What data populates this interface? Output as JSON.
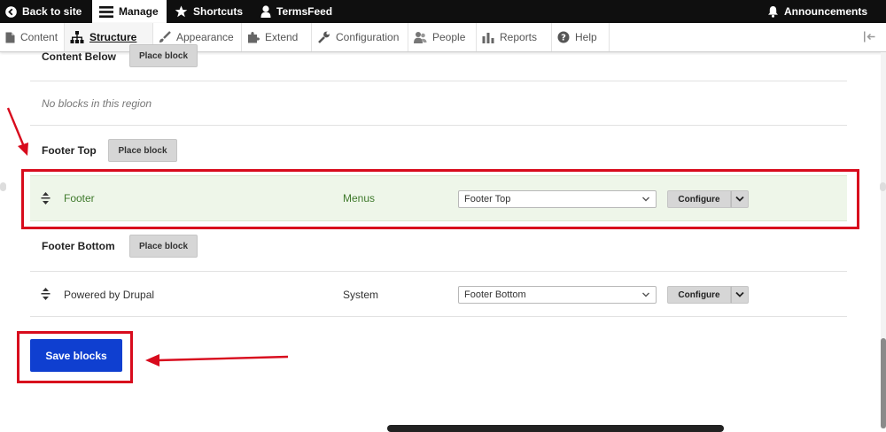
{
  "toolbar": {
    "back_to_site": "Back to site",
    "manage": "Manage",
    "shortcuts": "Shortcuts",
    "user": "TermsFeed",
    "announcements": "Announcements"
  },
  "tray": {
    "items": [
      {
        "label": "Content"
      },
      {
        "label": "Structure"
      },
      {
        "label": "Appearance"
      },
      {
        "label": "Extend"
      },
      {
        "label": "Configuration"
      },
      {
        "label": "People"
      },
      {
        "label": "Reports"
      },
      {
        "label": "Help"
      }
    ]
  },
  "regions": {
    "content_below": {
      "title": "Content Below",
      "place_block": "Place block",
      "empty": "No blocks in this region"
    },
    "footer_top": {
      "title": "Footer Top",
      "place_block": "Place block"
    },
    "footer_bottom": {
      "title": "Footer Bottom",
      "place_block": "Place block"
    }
  },
  "blocks": [
    {
      "name": "Footer",
      "category": "Menus",
      "region": "Footer Top",
      "configure": "Configure"
    },
    {
      "name": "Powered by Drupal",
      "category": "System",
      "region": "Footer Bottom",
      "configure": "Configure"
    }
  ],
  "save_button": "Save blocks",
  "colors": {
    "toolbar_bg": "#0f0f0f",
    "save_button": "#0f3fd0",
    "highlight_row": "#eef6e9",
    "block_green_text": "#3f7a2c",
    "annotation_red": "#d80b1d"
  }
}
